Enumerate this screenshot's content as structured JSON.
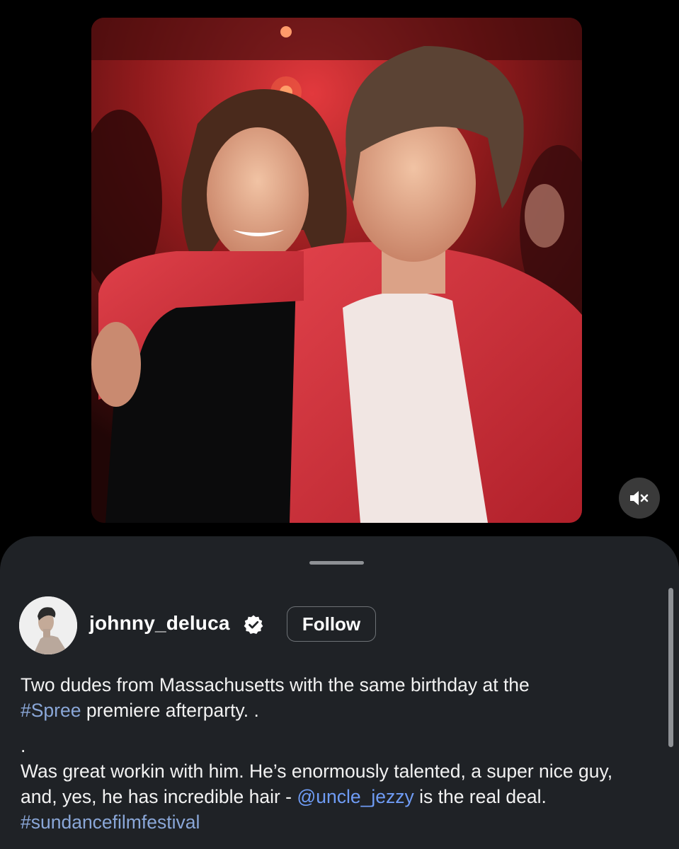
{
  "post": {
    "username": "johnny_deluca",
    "follow_label": "Follow",
    "verified": true,
    "caption": {
      "line1_text": "Two dudes from Massachusetts with the same birthday at the",
      "hashtag1": "#Spree",
      "line2_text": " premiere afterparty. .",
      "dot_line": ".",
      "para2_text": "Was great workin with him. He’s enormously talented, a super nice guy, and, yes, he has incredible hair - ",
      "mention": "@uncle_jezzy",
      "para2_tail": " is the real deal. ",
      "hashtag2": "#sundancefilmfestival"
    }
  },
  "media": {
    "type": "photo",
    "audio_state": "muted",
    "mute_icon": "speaker-muted-icon"
  },
  "colors": {
    "background": "#000000",
    "sheet": "#1f2226",
    "hashtag": "#8aa7d8",
    "mention": "#6f9cf5",
    "accent_red": "#d8323d"
  }
}
